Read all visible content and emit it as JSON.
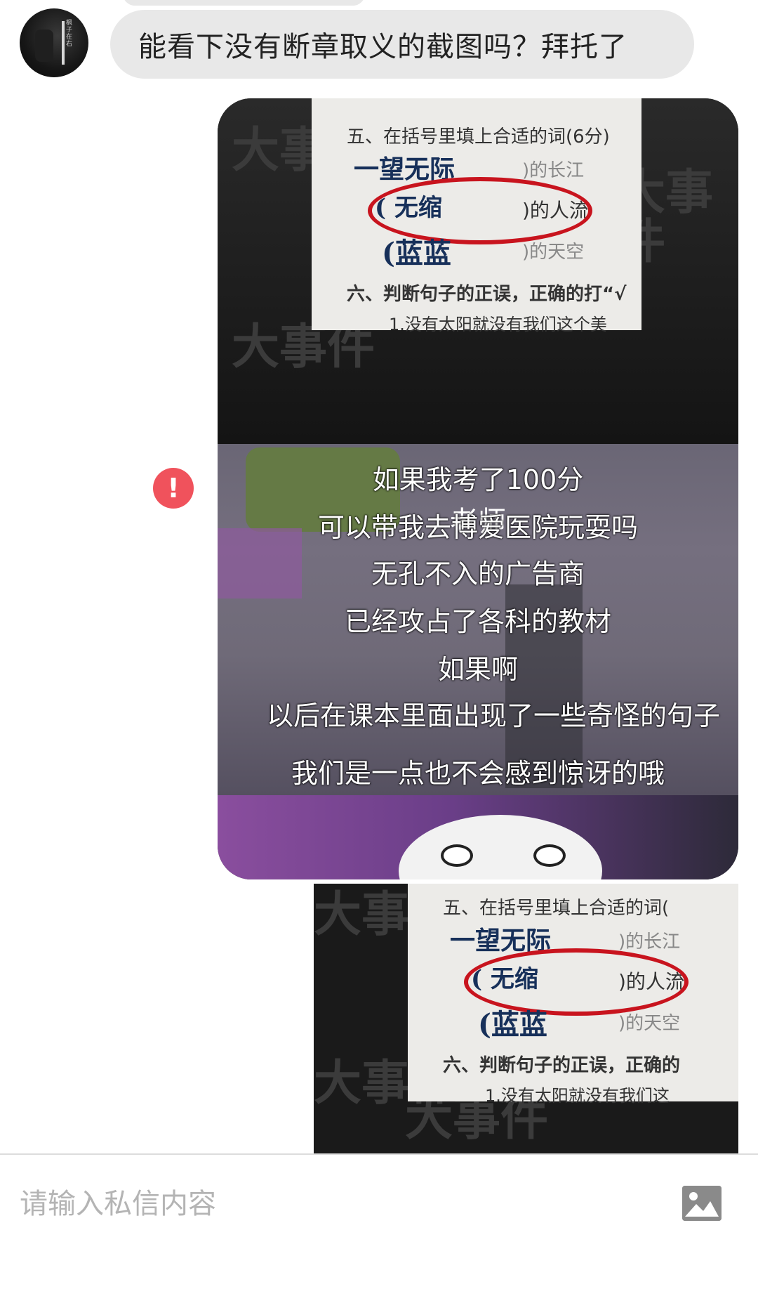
{
  "conversation": {
    "incoming_message": "能看下没有断章取义的截图吗？拜托了",
    "avatar_sign": "枫子在右"
  },
  "attachment_1": {
    "exam": {
      "section5": "五、在括号里填上合适的词(6分)",
      "row1_hand": "一望无际",
      "row1_text": ")的长江",
      "row2_hand": "(  无缩",
      "row2_text": ")的人流",
      "row3_hand": "(蓝蓝",
      "row3_text": ")的天空",
      "section6": "六、判断句子的正误，正确的打“√",
      "line1": "1.没有太阳就没有我们这个美"
    },
    "caption_header": "老师",
    "subtitles": [
      "如果我考了100分",
      "可以带我去博爱医院玩耍吗",
      "无孔不入的广告商",
      "已经攻占了各科的教材",
      "如果啊",
      "以后在课本里面出现了一些奇怪的句子",
      "我们是一点也不会感到惊讶的哦"
    ],
    "watermark": "大事件"
  },
  "attachment_2": {
    "section5": "五、在括号里填上合适的词(",
    "row1_hand": "一望无际",
    "row1_text": ")的长江",
    "row2_hand": "(  无缩",
    "row2_text": ")的人流",
    "row3_hand": "(蓝蓝",
    "row3_text": ")的天空",
    "section6": "六、判断句子的正误，正确的",
    "line1": "1.没有太阳就没有我们这"
  },
  "status": {
    "send_failed_icon": "exclamation-icon",
    "send_failed_glyph": "!"
  },
  "composer": {
    "placeholder": "请输入私信内容",
    "image_icon": "image-icon"
  },
  "colors": {
    "bubble": "#e8e8e8",
    "error": "#f0525c",
    "circle_red": "#c8141e"
  }
}
